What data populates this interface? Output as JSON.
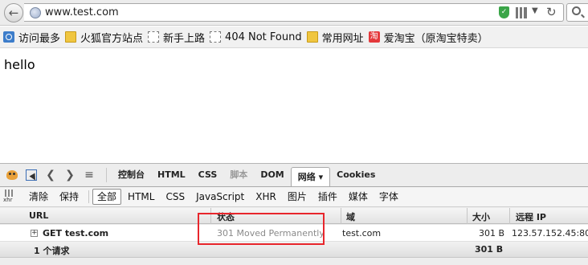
{
  "browser": {
    "url": "www.test.com",
    "back_glyph": "←",
    "shield_glyph": "✓",
    "reload_glyph": "↻",
    "dropdown_glyph": "▼"
  },
  "bookmarks": [
    {
      "label": "访问最多",
      "icon": "most-visited-icon"
    },
    {
      "label": "火狐官方站点",
      "icon": "folder-icon"
    },
    {
      "label": "新手上路",
      "icon": "page-icon"
    },
    {
      "label": "404 Not Found",
      "icon": "page-icon"
    },
    {
      "label": "常用网址",
      "icon": "folder-icon"
    },
    {
      "label": "爱淘宝（原淘宝特卖）",
      "icon": "taobao-icon",
      "icon_text": "淘"
    }
  ],
  "page": {
    "text": "hello"
  },
  "devtools": {
    "tool_icons": {
      "back": "❮",
      "forward": "❯",
      "command": "≡"
    },
    "tabs": [
      {
        "label": "控制台",
        "state": "normal"
      },
      {
        "label": "HTML",
        "state": "normal"
      },
      {
        "label": "CSS",
        "state": "normal"
      },
      {
        "label": "脚本",
        "state": "disabled"
      },
      {
        "label": "DOM",
        "state": "normal"
      },
      {
        "label": "网络",
        "state": "active",
        "suffix": "▾"
      },
      {
        "label": "Cookies",
        "state": "normal"
      }
    ],
    "filter": {
      "xhr_icon_text": "xhr",
      "clear": "清除",
      "persist": "保持",
      "types": [
        "全部",
        "HTML",
        "CSS",
        "JavaScript",
        "XHR",
        "图片",
        "插件",
        "媒体",
        "字体"
      ],
      "active_type": "全部"
    },
    "columns": {
      "url": "URL",
      "status": "状态",
      "domain": "域",
      "size": "大小",
      "remote_ip": "远程 IP"
    },
    "requests": [
      {
        "expand": "+",
        "url": "GET test.com",
        "status": "301 Moved Permanently",
        "domain": "test.com",
        "size": "301 B",
        "remote_ip": "123.57.152.45:80"
      }
    ],
    "summary": {
      "count": "1 个请求",
      "total_size": "301 B"
    }
  },
  "colors": {
    "highlight": "#e8262c",
    "status_text": "#8a8a8a",
    "shield": "#3aa548"
  }
}
